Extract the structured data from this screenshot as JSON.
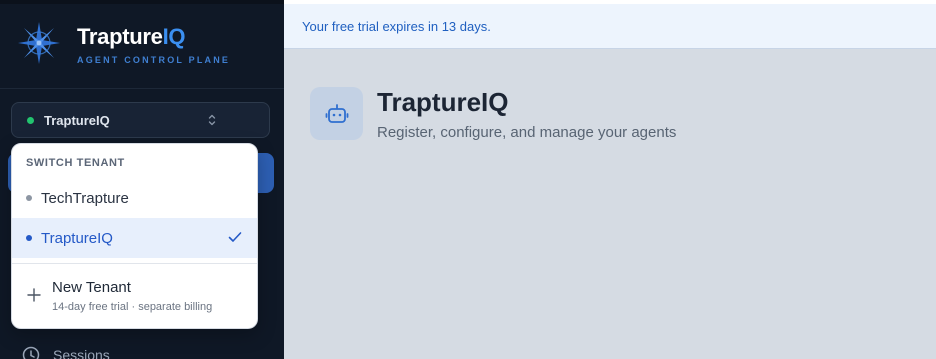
{
  "brand": {
    "name_part1": "Trapture",
    "name_part2": "IQ",
    "tagline": "AGENT CONTROL PLANE"
  },
  "tenant_selector": {
    "current": "TraptureIQ",
    "status_color": "#22c46f"
  },
  "tenant_dropdown": {
    "heading": "SWITCH TENANT",
    "tenants": [
      {
        "name": "TechTrapture",
        "selected": false
      },
      {
        "name": "TraptureIQ",
        "selected": true
      }
    ],
    "new_tenant": {
      "title": "New Tenant",
      "subtitle": "14-day free trial · separate billing"
    }
  },
  "sidebar": {
    "partial_item_label": "Sessions",
    "active_color": "#2d5fb3"
  },
  "banner": {
    "text": "Your free trial expires in 13 days."
  },
  "page": {
    "title": "TraptureIQ",
    "subtitle": "Register, configure, and manage your agents"
  },
  "icons": {
    "logo": "compass-star-icon",
    "chevron": "chevron-up-down-icon",
    "check": "check-icon",
    "plus": "plus-icon",
    "clock": "clock-icon",
    "agent": "robot-icon"
  }
}
